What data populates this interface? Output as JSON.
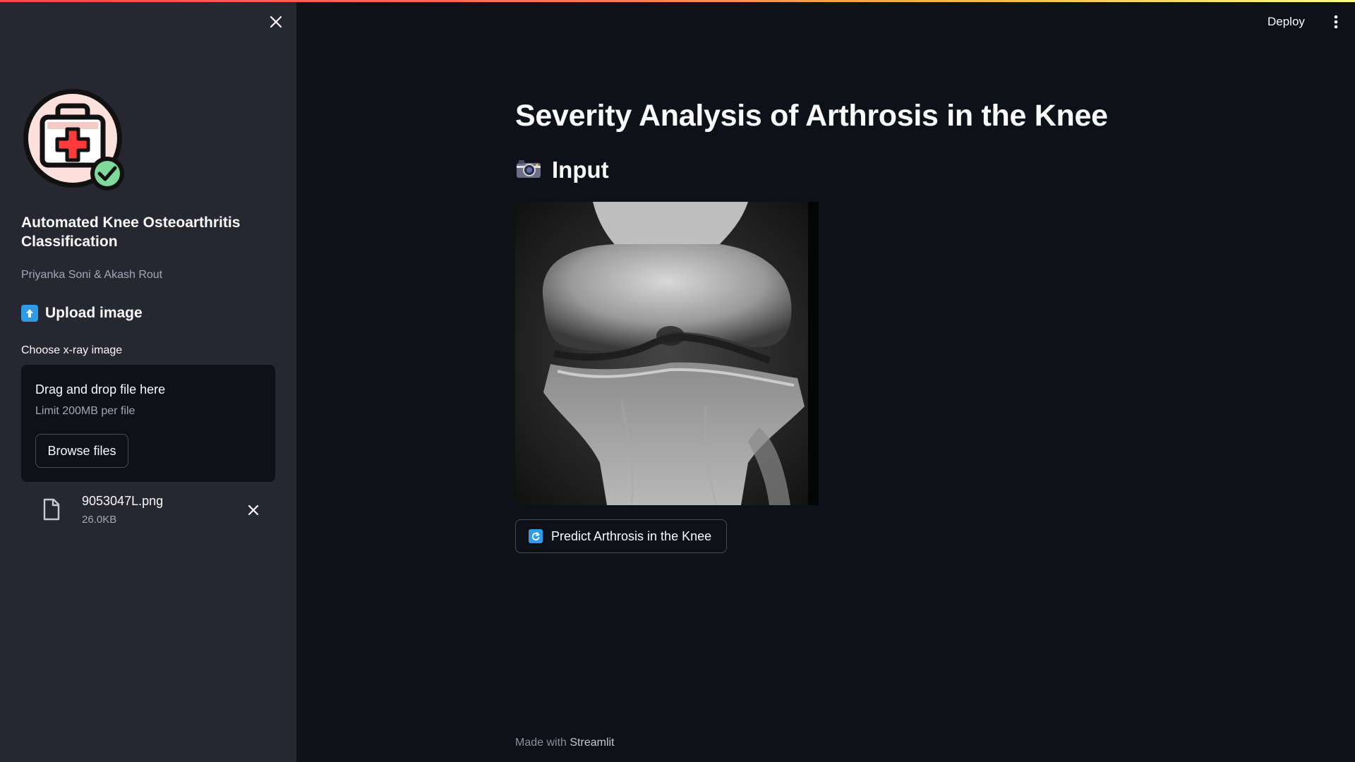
{
  "header": {
    "deploy_label": "Deploy",
    "menu_icon": "kebab-menu-icon"
  },
  "sidebar": {
    "close_icon": "close-icon",
    "logo_icon": "medical-kit-check-icon",
    "app_title": "Automated Knee Osteoarthritis Classification",
    "authors": "Priyanka Soni & Akash Rout",
    "upload_heading": "Upload image",
    "upload_icon": "up-arrow-emoji-icon",
    "uploader": {
      "label": "Choose x-ray image",
      "drop_text": "Drag and drop file here",
      "limit_text": "Limit 200MB per file",
      "browse_label": "Browse files"
    },
    "uploaded_file": {
      "name": "9053047L.png",
      "size": "26.0KB",
      "file_icon": "file-icon",
      "remove_icon": "close-icon"
    }
  },
  "main": {
    "title": "Severity Analysis of Arthrosis in the Knee",
    "input_heading": "Input",
    "input_icon": "camera-emoji-icon",
    "predict_button": "Predict Arthrosis in the Knee",
    "predict_icon": "arrows-counterclockwise-emoji-icon"
  },
  "footer": {
    "made_with": "Made with",
    "brand": "Streamlit"
  },
  "colors": {
    "main_bg": "#0e1117",
    "sidebar_bg": "#262730",
    "text": "#fafafa",
    "muted_text": "#a3a8b8",
    "accent_blue": "#2f9be6",
    "top_gradient_start": "#ff4b4b",
    "top_gradient_end": "#fffd80"
  }
}
